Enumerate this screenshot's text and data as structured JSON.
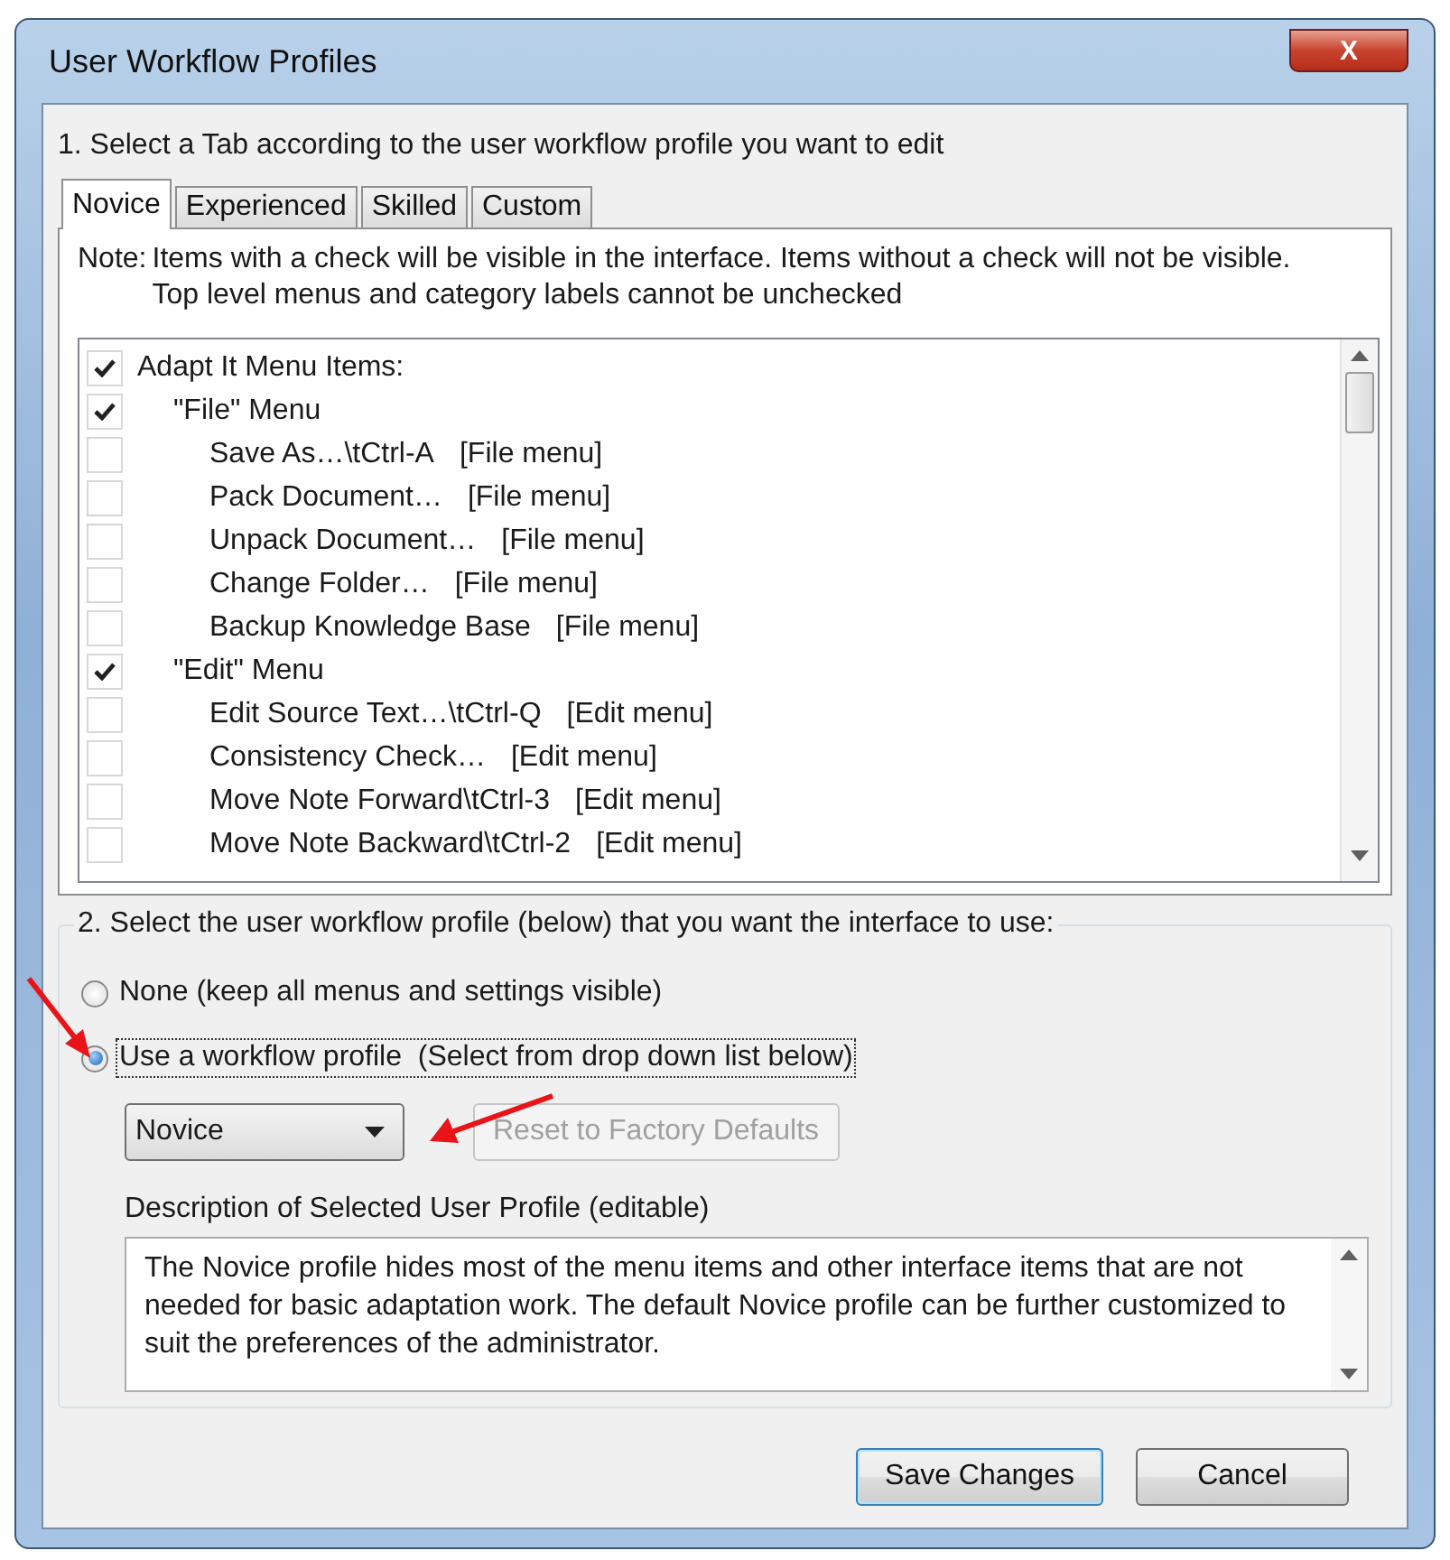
{
  "window": {
    "title": "User Workflow Profiles",
    "close_label": "X"
  },
  "step1": {
    "label": "1. Select a Tab according to the user workflow profile you want to edit"
  },
  "tabs": [
    {
      "label": "Novice",
      "selected": true
    },
    {
      "label": "Experienced",
      "selected": false
    },
    {
      "label": "Skilled",
      "selected": false
    },
    {
      "label": "Custom",
      "selected": false
    }
  ],
  "note": {
    "label": "Note:",
    "lines": [
      "Items with a check will be visible in the interface. Items without a check will not be visible.",
      "Top level menus and category labels cannot be unchecked"
    ]
  },
  "items": [
    {
      "label": "Adapt It Menu Items:",
      "checked": true,
      "children": [
        {
          "label": "\"File\" Menu",
          "checked": true,
          "children": [
            {
              "label": "Save As…\\tCtrl-A",
              "menu": "[File menu]",
              "checked": false
            },
            {
              "label": "Pack Document…",
              "menu": "[File menu]",
              "checked": false
            },
            {
              "label": "Unpack Document…",
              "menu": "[File menu]",
              "checked": false
            },
            {
              "label": "Change Folder…",
              "menu": "[File menu]",
              "checked": false
            },
            {
              "label": "Backup Knowledge Base",
              "menu": "[File menu]",
              "checked": false
            }
          ]
        },
        {
          "label": "\"Edit\" Menu",
          "checked": true,
          "children": [
            {
              "label": "Edit Source Text…\\tCtrl-Q",
              "menu": "[Edit menu]",
              "checked": false
            },
            {
              "label": "Consistency Check…",
              "menu": "[Edit menu]",
              "checked": false
            },
            {
              "label": "Move Note Forward\\tCtrl-3",
              "menu": "[Edit menu]",
              "checked": false
            },
            {
              "label": "Move Note Backward\\tCtrl-2",
              "menu": "[Edit menu]",
              "checked": false
            }
          ]
        }
      ]
    }
  ],
  "step2": {
    "label": "2. Select the user workflow profile (below) that you want the interface to use:"
  },
  "radios": [
    {
      "label": "None (keep all menus and settings visible)",
      "selected": false
    },
    {
      "label": "Use a workflow profile  (Select from drop down list below)",
      "selected": true
    }
  ],
  "profile_dropdown": {
    "value": "Novice"
  },
  "reset_button": {
    "label": "Reset to Factory Defaults",
    "disabled": true
  },
  "description": {
    "label": "Description of Selected User Profile (editable)",
    "value": "The Novice profile hides most of the menu items and other interface items that are not needed for basic adaptation work. The default Novice profile can be further customized to suit the preferences of the administrator."
  },
  "buttons": [
    {
      "label": "Save Changes",
      "default": true
    },
    {
      "label": "Cancel",
      "default": false
    }
  ]
}
